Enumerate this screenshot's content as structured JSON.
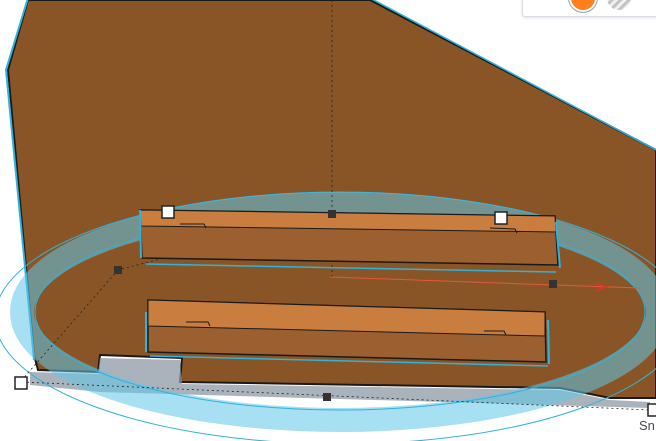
{
  "colors": {
    "shape": "#8a5526",
    "shape_top": "#c97d3f",
    "selection": "#2fb2dc",
    "solid": "#ff7f1e"
  },
  "viewport": {
    "dimension_label": "Sn"
  },
  "color_panel": {
    "solid_icon": "solid-color-icon",
    "hole_icon": "hole-pattern-icon"
  }
}
